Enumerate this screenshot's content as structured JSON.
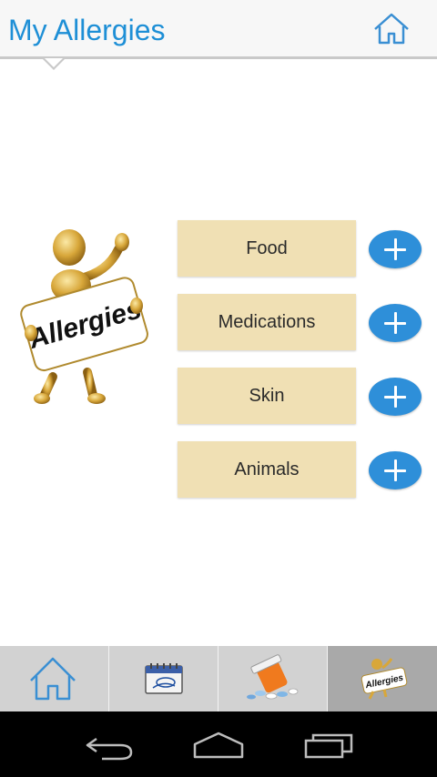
{
  "action_bar": {
    "title": "My Allergies",
    "home_icon": "home-icon"
  },
  "illustration": {
    "sign_text": "Allergies",
    "icon": "allergies-figure-icon"
  },
  "categories": [
    {
      "label": "Food",
      "add_icon": "plus-icon"
    },
    {
      "label": "Medications",
      "add_icon": "plus-icon"
    },
    {
      "label": "Skin",
      "add_icon": "plus-icon"
    },
    {
      "label": "Animals",
      "add_icon": "plus-icon"
    }
  ],
  "tabs": [
    {
      "icon": "home-icon",
      "selected": false
    },
    {
      "icon": "calendar-icon",
      "selected": false
    },
    {
      "icon": "pill-bottle-icon",
      "selected": false
    },
    {
      "icon": "allergies-figure-icon",
      "selected": true,
      "sign_text": "Allergies"
    }
  ],
  "system_nav": {
    "icons": [
      "back-icon",
      "home-outline-icon",
      "recent-apps-icon"
    ]
  },
  "colors": {
    "title": "#1e8fd6",
    "button_bg": "#f0e0b4",
    "plus_bg": "#2e8fd9",
    "tab_bar_bg": "#d2d2d2",
    "tab_selected_bg": "#a9a9a9"
  }
}
